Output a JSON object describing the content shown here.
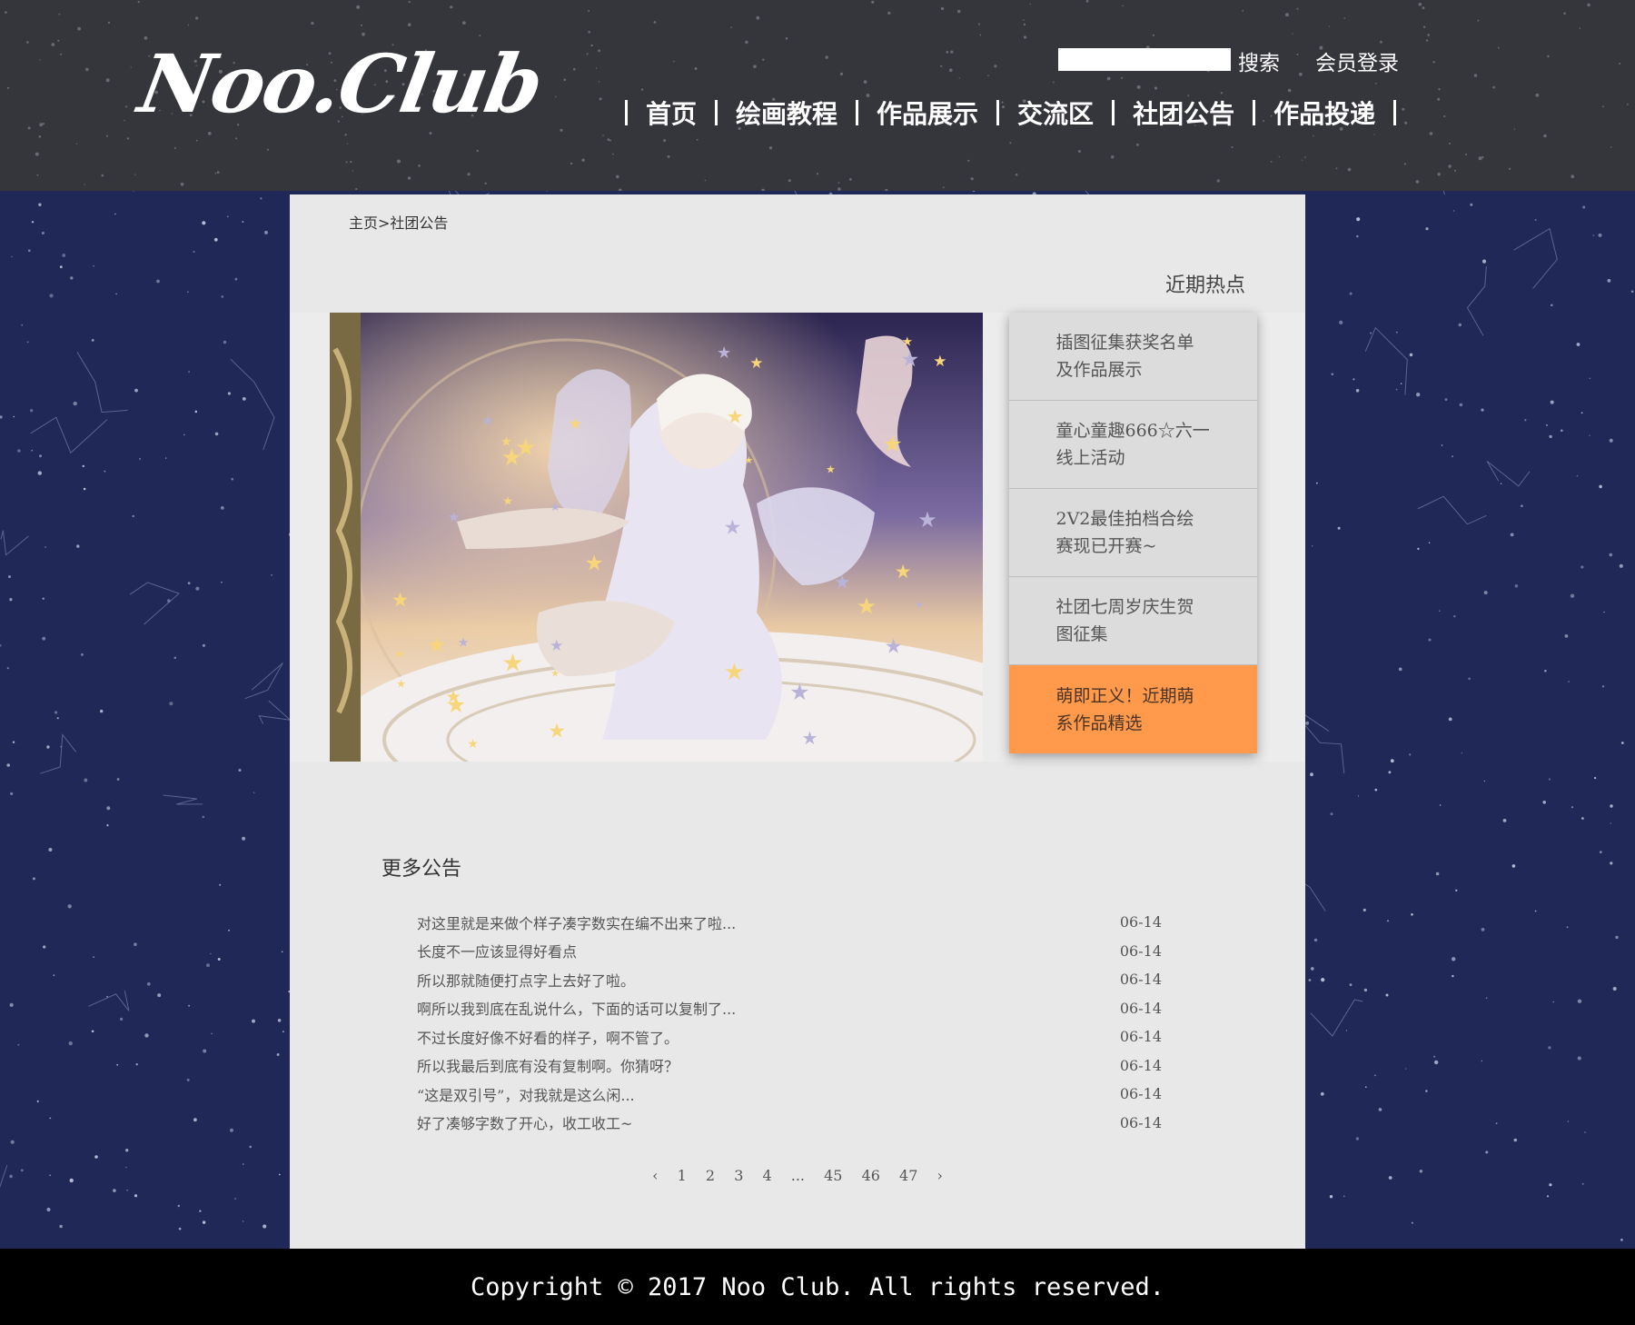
{
  "header": {
    "logo": "Noo.Club",
    "search_button": "搜索",
    "login_link": "会员登录",
    "nav": [
      "首页",
      "绘画教程",
      "作品展示",
      "交流区",
      "社团公告",
      "作品投递"
    ]
  },
  "breadcrumb": "主页>社团公告",
  "hot": {
    "title": "近期热点",
    "items": [
      "插图征集获奖名单及作品展示",
      "童心童趣666☆六一线上活动",
      "2V2最佳拍档合绘赛现已开赛~",
      "社团七周岁庆生贺图征集",
      "萌即正义！近期萌系作品精选"
    ],
    "active_index": 4,
    "active_color": "#ff9a4c"
  },
  "more": {
    "title": "更多公告",
    "notices": [
      {
        "text": "对这里就是来做个样子凑字数实在编不出来了啦...",
        "date": "06-14"
      },
      {
        "text": "长度不一应该显得好看点",
        "date": "06-14"
      },
      {
        "text": "所以那就随便打点字上去好了啦。",
        "date": "06-14"
      },
      {
        "text": "啊所以我到底在乱说什么，下面的话可以复制了...",
        "date": "06-14"
      },
      {
        "text": "不过长度好像不好看的样子，啊不管了。",
        "date": "06-14"
      },
      {
        "text": "所以我最后到底有没有复制啊。你猜呀？",
        "date": "06-14"
      },
      {
        "text": "“这是双引号”，对我就是这么闲...",
        "date": "06-14"
      },
      {
        "text": "好了凑够字数了开心，收工收工~",
        "date": "06-14"
      }
    ]
  },
  "pagination": {
    "prev": "‹",
    "pages": [
      "1",
      "2",
      "3",
      "4"
    ],
    "ellipsis": "...",
    "last_pages": [
      "45",
      "46",
      "47"
    ],
    "next": "›"
  },
  "footer": "Copyright © 2017 Noo Club. All rights reserved.",
  "colors": {
    "page_bg": "#1f2856",
    "header_bg": "#35353c",
    "panel_bg": "#e8e8e8",
    "accent": "#ff9a4c"
  }
}
